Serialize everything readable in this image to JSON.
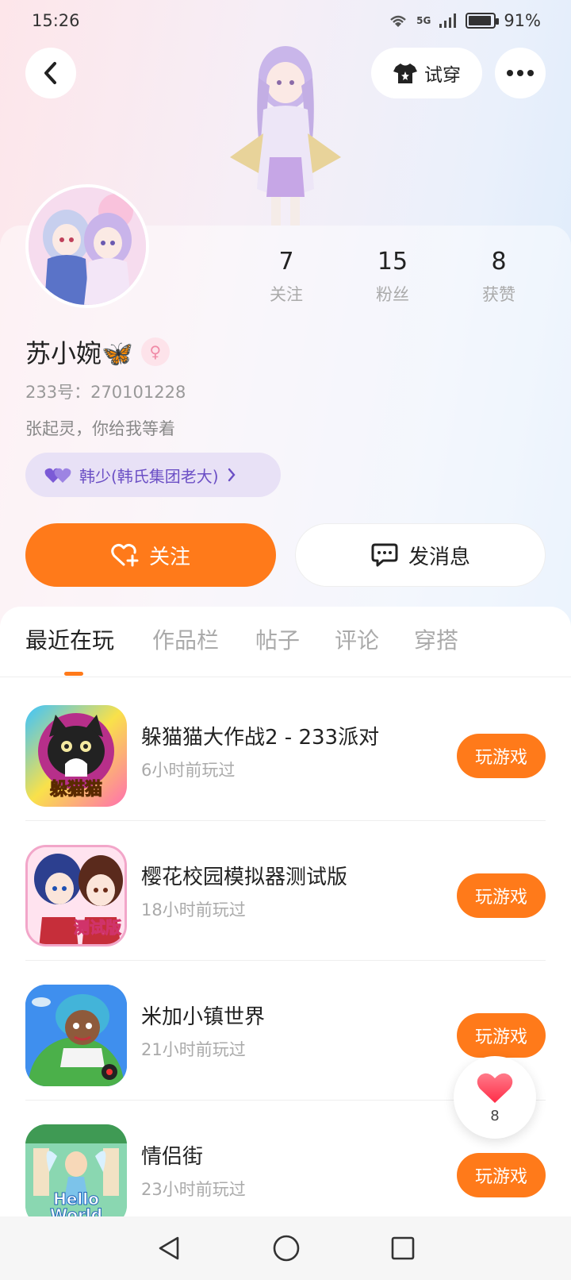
{
  "status_bar": {
    "time": "15:26",
    "network": "5G",
    "battery": "91%"
  },
  "header": {
    "back_icon": "chevron-left-icon",
    "tryon_label": "试穿",
    "more_icon": "more-dots-icon"
  },
  "profile": {
    "name": "苏小婉🦋",
    "gender_icon": "female-icon",
    "uid": "233号：270101228",
    "bio": "张起灵，你给我等着",
    "relation_tag": "韩少(韩氏集团老大)",
    "stats": [
      {
        "value": "7",
        "label": "关注"
      },
      {
        "value": "15",
        "label": "粉丝"
      },
      {
        "value": "8",
        "label": "获赞"
      }
    ]
  },
  "actions": {
    "follow_label": "关注",
    "message_label": "发消息"
  },
  "tabs": [
    {
      "label": "最近在玩",
      "active": true
    },
    {
      "label": "作品栏",
      "active": false
    },
    {
      "label": "帖子",
      "active": false
    },
    {
      "label": "评论",
      "active": false
    },
    {
      "label": "穿搭",
      "active": false
    }
  ],
  "games": [
    {
      "title": "躲猫猫大作战2 - 233派对",
      "time": "6小时前玩过",
      "button": "玩游戏",
      "icon_text": "躲猫猫"
    },
    {
      "title": "樱花校园模拟器测试版",
      "time": "18小时前玩过",
      "button": "玩游戏",
      "icon_text": "测试版"
    },
    {
      "title": "米加小镇世界",
      "time": "21小时前玩过",
      "button": "玩游戏",
      "icon_text": ""
    },
    {
      "title": "情侣街",
      "time": "23小时前玩过",
      "button": "玩游戏",
      "icon_text": "Hello World"
    }
  ],
  "like_fab": {
    "count": "8"
  },
  "colors": {
    "accent": "#ff7a1a",
    "relation_text": "#6b4fc5"
  }
}
